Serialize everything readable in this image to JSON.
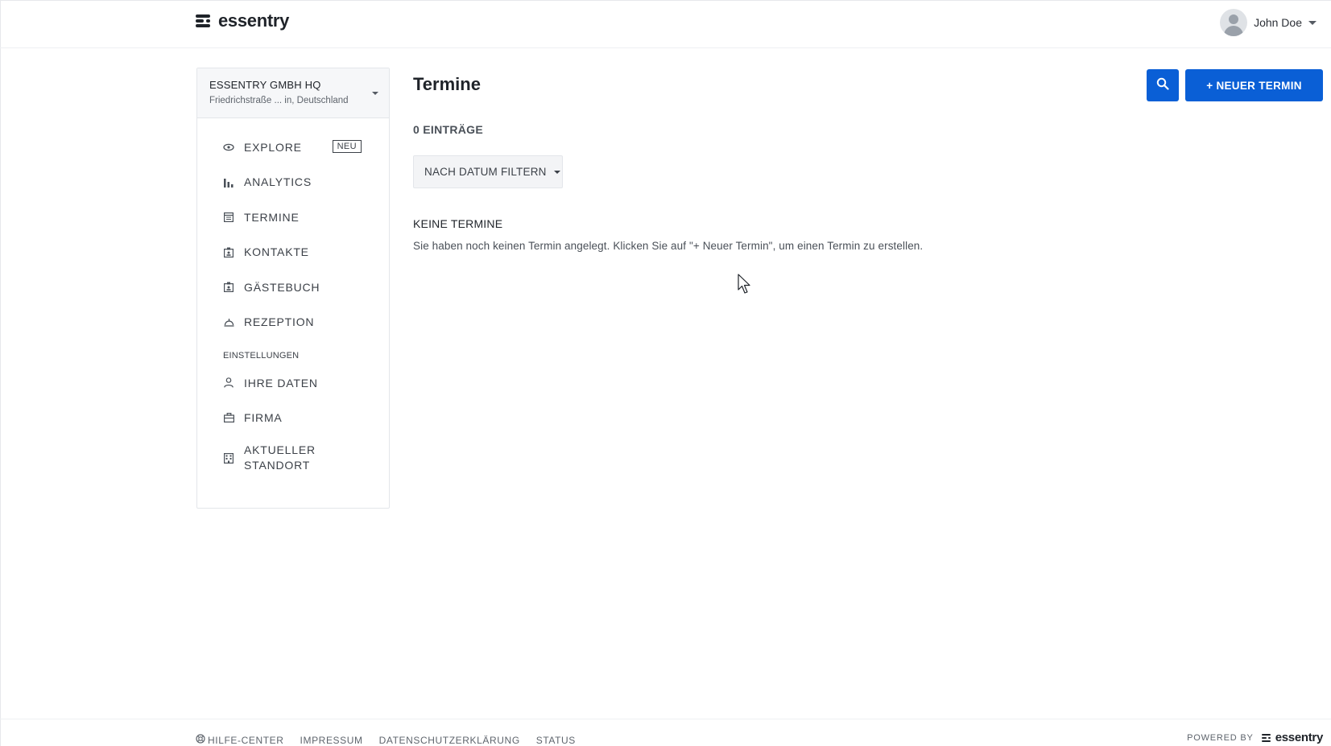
{
  "header": {
    "logo_text": "essentry",
    "user_name": "John Doe"
  },
  "sidebar": {
    "location_name": "ESSENTRY GMBH HQ",
    "location_address": "Friedrichstraße ... in, Deutschland",
    "items": [
      {
        "label": "EXPLORE",
        "icon": "eye-icon",
        "badge": "NEU"
      },
      {
        "label": "ANALYTICS",
        "icon": "bar-chart-icon"
      },
      {
        "label": "TERMINE",
        "icon": "calendar-icon"
      },
      {
        "label": "KONTAKTE",
        "icon": "badge-icon"
      },
      {
        "label": "GÄSTEBUCH",
        "icon": "badge-icon"
      },
      {
        "label": "REZEPTION",
        "icon": "reception-bell-icon"
      }
    ],
    "settings_heading": "EINSTELLUNGEN",
    "settings_items": [
      {
        "label": "IHRE DATEN",
        "icon": "person-icon"
      },
      {
        "label": "FIRMA",
        "icon": "briefcase-icon"
      },
      {
        "label_line1": "AKTUELLER",
        "label_line2": "STANDORT",
        "icon": "building-icon"
      }
    ]
  },
  "main": {
    "title": "Termine",
    "new_button": "+ NEUER TERMIN",
    "count": "0 EINTRÄGE",
    "filter_label": "NACH DATUM FILTERN",
    "empty_title": "KEINE TERMINE",
    "empty_text": "Sie haben noch keinen Termin angelegt. Klicken Sie auf \"+ Neuer Termin\", um einen Termin zu erstellen."
  },
  "footer": {
    "links": [
      "HILFE-CENTER",
      "IMPRESSUM",
      "DATENSCHUTZERKLÄRUNG",
      "STATUS"
    ],
    "powered_by": "POWERED BY",
    "logo_text": "essentry"
  },
  "colors": {
    "accent": "#0a5fd6",
    "text": "#1f2329",
    "muted": "#4a5058"
  }
}
